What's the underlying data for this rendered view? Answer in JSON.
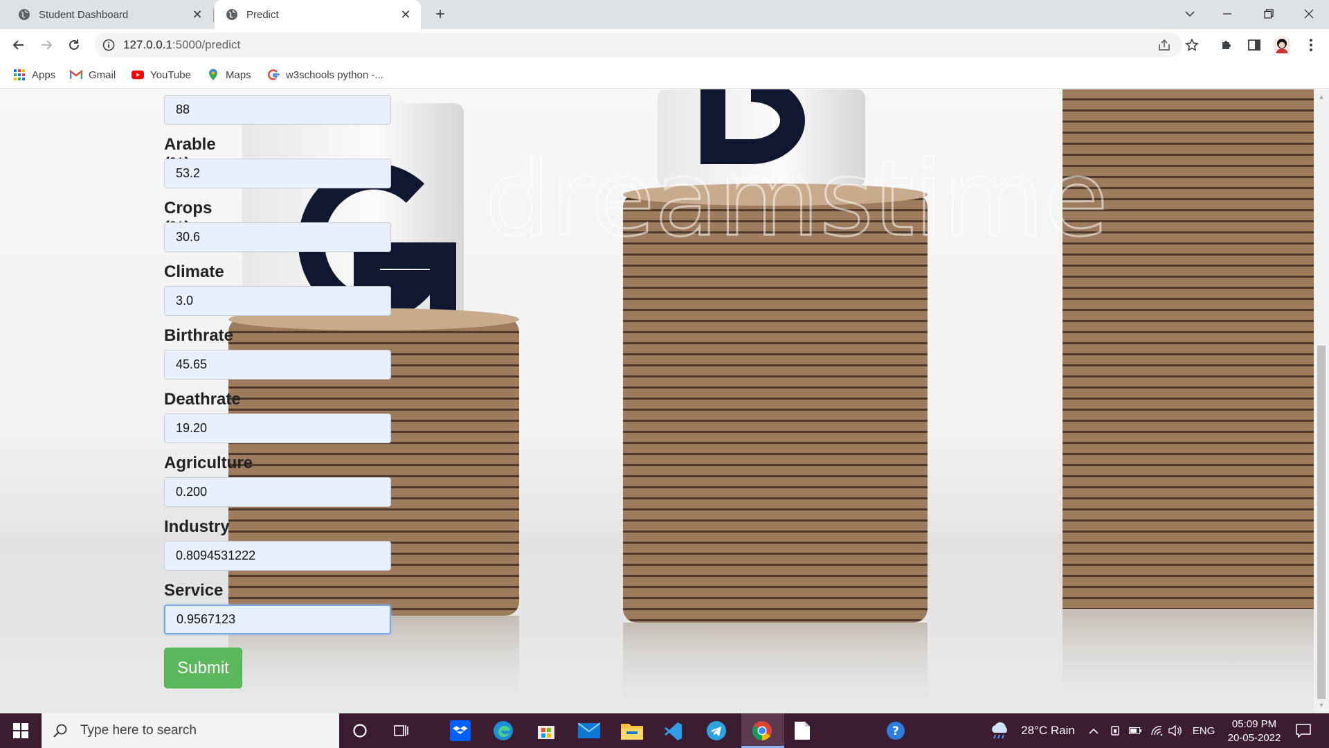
{
  "browser": {
    "tabs": [
      {
        "title": "Student Dashboard",
        "active": false
      },
      {
        "title": "Predict",
        "active": true
      }
    ],
    "url_host": "127.0.0.1",
    "url_rest": ":5000/predict",
    "bookmarks": [
      "Apps",
      "Gmail",
      "YouTube",
      "Maps",
      "w3schools python -..."
    ]
  },
  "form": {
    "fields": [
      {
        "label": "",
        "value": "88"
      },
      {
        "label": "Arable (%)",
        "value": "53.2"
      },
      {
        "label": "Crops (%)",
        "value": "30.6"
      },
      {
        "label": "Climate",
        "value": "3.0"
      },
      {
        "label": "Birthrate",
        "value": "45.65"
      },
      {
        "label": "Deathrate",
        "value": "19.20"
      },
      {
        "label": "Agriculture",
        "value": "0.200"
      },
      {
        "label": "Industry",
        "value": "0.8094531222"
      },
      {
        "label": "Service",
        "value": "0.9567123"
      }
    ],
    "submit_label": "Submit"
  },
  "taskbar": {
    "search_placeholder": "Type here to search",
    "weather": "28°C  Rain",
    "language": "ENG",
    "time": "05:09 PM",
    "date": "20-05-2022"
  }
}
